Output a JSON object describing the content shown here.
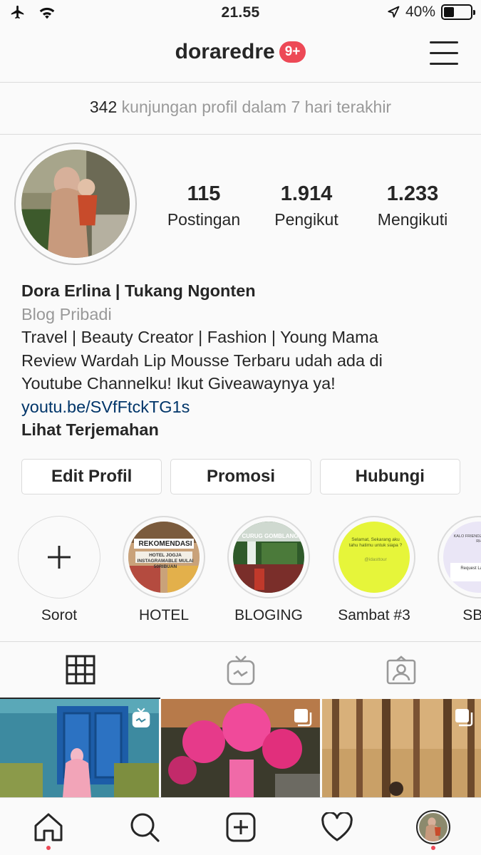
{
  "status_bar": {
    "time": "21.55",
    "battery_text": "40%",
    "battery_level": 0.4,
    "icons": [
      "airplane-icon",
      "wifi-icon",
      "location-arrow-icon",
      "battery-icon"
    ]
  },
  "header": {
    "username": "doraredre",
    "notification_badge": "9+",
    "menu_icon": "hamburger-menu-icon"
  },
  "visits": {
    "count": "342",
    "text": "kunjungan profil dalam 7 hari terakhir"
  },
  "profile": {
    "stats": [
      {
        "value": "115",
        "label": "Postingan"
      },
      {
        "value": "1.914",
        "label": "Pengikut"
      },
      {
        "value": "1.233",
        "label": "Mengikuti"
      }
    ],
    "name": "Dora Erlina | Tukang Ngonten",
    "category": "Blog Pribadi",
    "bio_lines": [
      "Travel | Beauty Creator | Fashion | Young Mama",
      "Review Wardah Lip Mousse Terbaru udah ada di",
      "Youtube Channelku! Ikut Giveawaynya ya!"
    ],
    "link": "youtu.be/SVfFtckTG1s",
    "translate": "Lihat Terjemahan"
  },
  "actions": {
    "edit": "Edit Profil",
    "promo": "Promosi",
    "contact": "Hubungi"
  },
  "highlights": [
    {
      "label": "Sorot",
      "cover_text": ""
    },
    {
      "label": "HOTEL",
      "cover_text": "REKOMENDASI",
      "cover_sub": "HOTEL JOGJA INSTAGRAMABLE MULAI 50RIBUAN"
    },
    {
      "label": "BLOGING",
      "cover_text": "CURUG GOMBLANG",
      "cover_sub": ""
    },
    {
      "label": "Sambat #3",
      "cover_text": "Selamat, Sekarang aku tahu hatimu untuk siapa ?",
      "cover_sub": "@idasttour"
    },
    {
      "label": "SB #",
      "cover_text": "KALO FRIENDZONE, ZONE, DI RHP...",
      "cover_sub": "Request La Hadiah Me"
    }
  ],
  "tabs": [
    {
      "name": "grid-icon",
      "active": true
    },
    {
      "name": "igtv-icon",
      "active": false
    },
    {
      "name": "tagged-icon",
      "active": false
    }
  ],
  "posts": [
    {
      "type": "igtv",
      "icon": "igtv-icon"
    },
    {
      "type": "carousel",
      "icon": "carousel-icon"
    },
    {
      "type": "carousel",
      "icon": "carousel-icon"
    }
  ],
  "bottom_nav": [
    {
      "name": "home-icon",
      "notification_dot": true
    },
    {
      "name": "search-icon",
      "notification_dot": false
    },
    {
      "name": "add-post-icon",
      "notification_dot": false
    },
    {
      "name": "activity-heart-icon",
      "notification_dot": false
    },
    {
      "name": "profile-avatar-icon",
      "notification_dot": true
    }
  ],
  "colors": {
    "badge": "#ed4956",
    "link": "#003569",
    "muted": "#999999",
    "border": "#dbdbdb",
    "highlight_yellow": "#e6f53a"
  }
}
